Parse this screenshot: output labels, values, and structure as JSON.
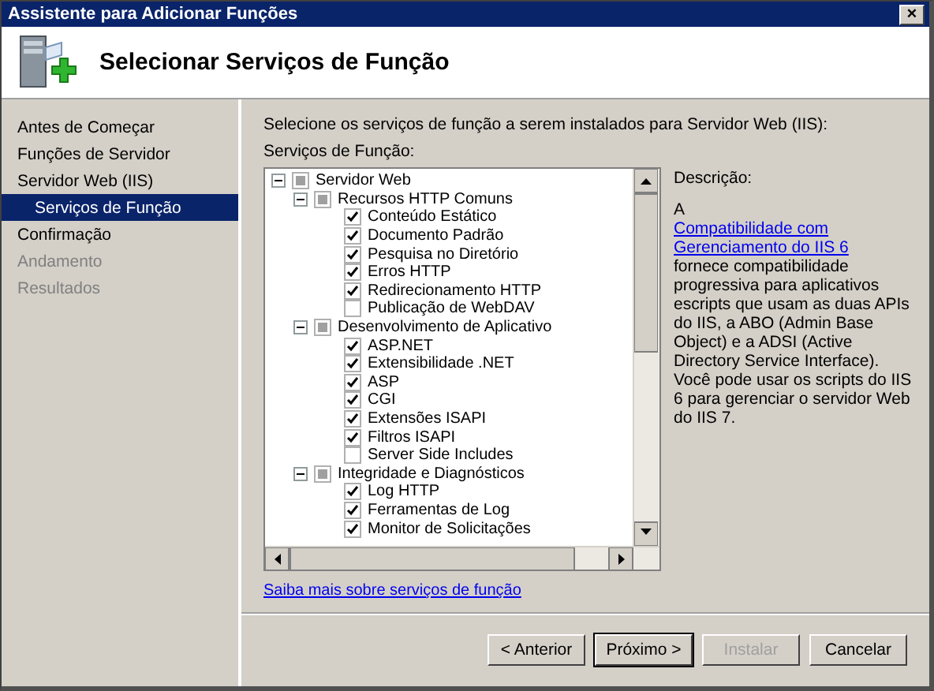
{
  "window": {
    "title": "Assistente para Adicionar Funções",
    "close": "×"
  },
  "header": {
    "title": "Selecionar Serviços de Função"
  },
  "nav": [
    {
      "label": "Antes de Começar",
      "selected": false,
      "disabled": false
    },
    {
      "label": "Funções de Servidor",
      "selected": false,
      "disabled": false
    },
    {
      "label": "Servidor Web (IIS)",
      "selected": false,
      "disabled": false,
      "children": [
        {
          "label": "Serviços de Função",
          "selected": true
        }
      ]
    },
    {
      "label": "Confirmação",
      "selected": false,
      "disabled": false
    },
    {
      "label": "Andamento",
      "selected": false,
      "disabled": true
    },
    {
      "label": "Resultados",
      "selected": false,
      "disabled": true
    }
  ],
  "instruction": "Selecione os serviços de função a serem instalados para Servidor Web (IIS):",
  "tree_label": "Serviços de Função:",
  "tree": [
    {
      "label": "Servidor Web",
      "partial": true,
      "expanded": true,
      "children": [
        {
          "label": "Recursos HTTP Comuns",
          "partial": true,
          "expanded": true,
          "children": [
            {
              "label": "Conteúdo Estático",
              "checked": true
            },
            {
              "label": "Documento Padrão",
              "checked": true
            },
            {
              "label": "Pesquisa no Diretório",
              "checked": true
            },
            {
              "label": "Erros HTTP",
              "checked": true
            },
            {
              "label": "Redirecionamento HTTP",
              "checked": true
            },
            {
              "label": "Publicação de WebDAV",
              "checked": false
            }
          ]
        },
        {
          "label": "Desenvolvimento de Aplicativo",
          "partial": true,
          "expanded": true,
          "children": [
            {
              "label": "ASP.NET",
              "checked": true
            },
            {
              "label": "Extensibilidade .NET",
              "checked": true
            },
            {
              "label": "ASP",
              "checked": true
            },
            {
              "label": "CGI",
              "checked": true
            },
            {
              "label": "Extensões ISAPI",
              "checked": true
            },
            {
              "label": "Filtros ISAPI",
              "checked": true
            },
            {
              "label": "Server Side Includes",
              "checked": false
            }
          ]
        },
        {
          "label": "Integridade e Diagnósticos",
          "partial": true,
          "expanded": true,
          "children": [
            {
              "label": "Log HTTP",
              "checked": true
            },
            {
              "label": "Ferramentas de Log",
              "checked": true
            },
            {
              "label": "Monitor de Solicitações",
              "checked": true
            }
          ]
        }
      ]
    }
  ],
  "description": {
    "label": "Descrição:",
    "prefix": "A ",
    "link": "Compatibilidade com Gerenciamento do IIS 6",
    "suffix": " fornece compatibilidade progressiva para aplicativos escripts que usam as duas APIs do IIS, a ABO (Admin Base Object) e a ADSI (Active Directory Service Interface). Você pode usar os scripts do IIS 6 para gerenciar o servidor Web do IIS 7."
  },
  "more_link": "Saiba mais sobre serviços de função",
  "buttons": [
    {
      "label": "< Anterior",
      "disabled": false,
      "default": false
    },
    {
      "label": "Próximo >",
      "disabled": false,
      "default": true
    },
    {
      "label": "Instalar",
      "disabled": true,
      "default": false
    },
    {
      "label": "Cancelar",
      "disabled": false,
      "default": false
    }
  ]
}
